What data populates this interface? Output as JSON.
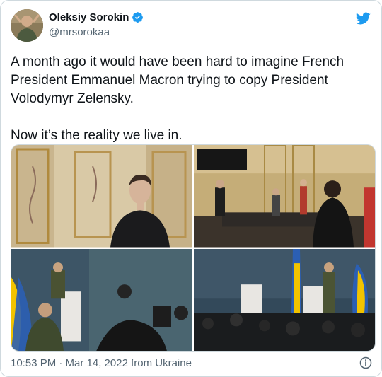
{
  "author": {
    "name": "Oleksiy Sorokin",
    "handle": "@mrsorokaa",
    "verified": true
  },
  "icons": {
    "avatar": "avatar",
    "verified": "verified-badge-icon",
    "brand": "twitter-bird-icon",
    "info": "info-icon"
  },
  "colors": {
    "brand_blue": "#1d9bf0",
    "text": "#0f1419",
    "muted": "#536471",
    "border": "#cfd9de"
  },
  "tweet": {
    "paragraph_1": "A month ago it would have been hard to imagine French President Emmanuel Macron trying to copy President Volodymyr Zelensky.",
    "paragraph_2": "Now it’s the reality we live in."
  },
  "media": [
    {
      "name": "photo-macron-hoodie-portrait"
    },
    {
      "name": "photo-macron-office-meeting"
    },
    {
      "name": "photo-zelensky-press-conference"
    },
    {
      "name": "photo-zelensky-press-conference-wide"
    }
  ],
  "footer": {
    "timestamp": "10:53 PM · Mar 14, 2022 from Ukraine"
  }
}
